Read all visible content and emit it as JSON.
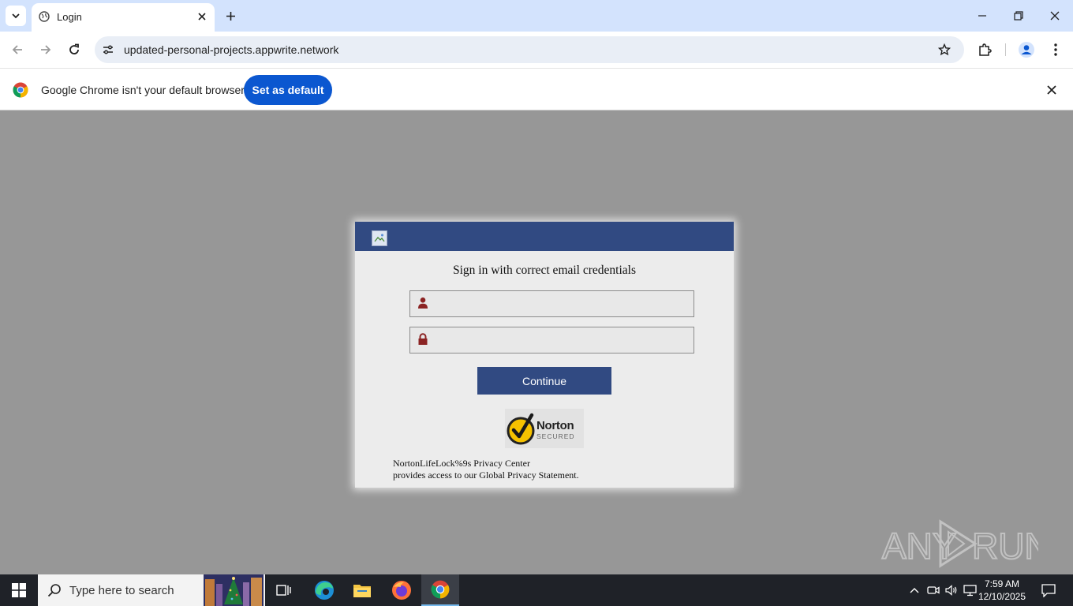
{
  "browser": {
    "tab": {
      "title": "Login"
    },
    "address_bar": {
      "url": "updated-personal-projects.appwrite.network"
    },
    "infobar": {
      "message": "Google Chrome isn't your default browser",
      "button_label": "Set as default"
    }
  },
  "login_form": {
    "heading": "Sign in with correct email credentials",
    "email_field": {
      "value": "",
      "placeholder": ""
    },
    "password_field": {
      "value": "",
      "placeholder": ""
    },
    "continue_label": "Continue",
    "badge": {
      "brand": "Norton",
      "subtext": "SECURED"
    },
    "privacy_line1": "NortonLifeLock%9s Privacy Center",
    "privacy_line2": "provides access to our Global Privacy Statement."
  },
  "watermark": {
    "text": "ANY RUN"
  },
  "taskbar": {
    "search_placeholder": "Type here to search",
    "clock": {
      "time": "7:59 AM",
      "date": "12/10/2025"
    }
  },
  "colors": {
    "page_overlay": "#979797",
    "card_header": "#314a82",
    "button_primary": "#314a82",
    "chrome_accent": "#0b57d0",
    "tabstrip": "#d3e3fd",
    "field_icon": "#8b2323"
  },
  "icons": {
    "tab": [
      "tab-search-icon",
      "globe-icon",
      "close-icon",
      "plus-icon"
    ],
    "window": [
      "minimize-icon",
      "restore-icon",
      "close-icon"
    ],
    "toolbar": [
      "back-arrow-icon",
      "forward-arrow-icon",
      "reload-icon",
      "site-info-icon",
      "star-icon",
      "extensions-icon",
      "profile-icon",
      "kebab-menu-icon"
    ],
    "form": [
      "user-icon",
      "lock-icon",
      "broken-image-icon",
      "norton-check-icon"
    ],
    "taskbar": [
      "windows-logo-icon",
      "search-icon",
      "task-view-icon",
      "edge-icon",
      "file-explorer-icon",
      "firefox-icon",
      "chrome-icon",
      "chevron-up-icon",
      "meet-now-icon",
      "volume-icon",
      "network-icon",
      "notification-icon"
    ]
  }
}
